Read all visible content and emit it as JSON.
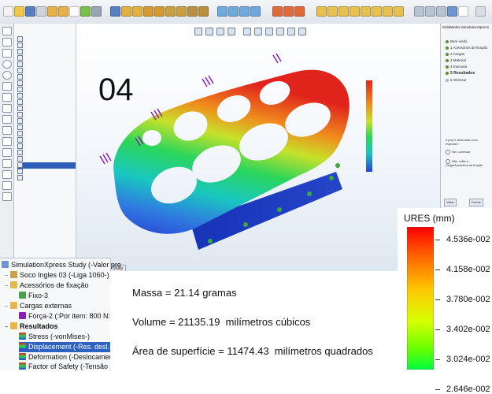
{
  "viewport": {
    "step_number": "04",
    "tab_label": "SimulationXpress Study"
  },
  "big_tree": {
    "items": [
      {
        "label": "SimulationXpress Study (-Valor pre",
        "level": 0,
        "bold": false,
        "selected": false,
        "icon": "study-icon"
      },
      {
        "label": "Soco Ingles 03 (-Liga 1060-)",
        "level": 1,
        "bold": false,
        "selected": false,
        "icon": "part-icon"
      },
      {
        "label": "Acessórios de fixação",
        "level": 1,
        "bold": false,
        "selected": false,
        "icon": "fixture-folder-icon"
      },
      {
        "label": "Fixo-3",
        "level": 2,
        "bold": false,
        "selected": false,
        "icon": "fixed-icon"
      },
      {
        "label": "Cargas externas",
        "level": 1,
        "bold": false,
        "selected": false,
        "icon": "loads-folder-icon"
      },
      {
        "label": "Força-2 (:Por item: 800 N:)",
        "level": 2,
        "bold": false,
        "selected": false,
        "icon": "force-icon"
      },
      {
        "label": "Resultados",
        "level": 1,
        "bold": true,
        "selected": false,
        "icon": "results-folder-icon"
      },
      {
        "label": "Stress (-vonMises-)",
        "level": 2,
        "bold": false,
        "selected": false,
        "icon": "plot-icon"
      },
      {
        "label": "Displacement (-Res. desl.-)",
        "level": 2,
        "bold": false,
        "selected": true,
        "icon": "plot-icon"
      },
      {
        "label": "Deformation (-Deslocamen",
        "level": 2,
        "bold": false,
        "selected": false,
        "icon": "plot-icon"
      },
      {
        "label": "Factor of Safety (-Tensão de",
        "level": 2,
        "bold": false,
        "selected": false,
        "icon": "plot-icon"
      }
    ]
  },
  "properties": {
    "mass": "Massa = 21.14 gramas",
    "volume": "Volume = 21135.19  milímetros cúbicos",
    "area": "Área de superfície = 11474.43  milímetros quadrados"
  },
  "legend": {
    "title": "URES (mm)",
    "ticks": [
      "4.536e-002",
      "4.158e-002",
      "3.780e-002",
      "3.402e-002",
      "3.024e-002",
      "2.646e-002"
    ],
    "values": [
      0.04536,
      0.04158,
      0.0378,
      0.03402,
      0.03024,
      0.02646
    ],
    "gradient_colors": [
      "#ff0000",
      "#ff6a00",
      "#ffc800",
      "#d7ff00",
      "#6cff00",
      "#00ff40"
    ]
  },
  "right_panel": {
    "title": "SolidWorks SimulationXpress",
    "steps": [
      {
        "label": "Bem-vindo",
        "active": false
      },
      {
        "label": "1  Acessórios de fixação",
        "active": false
      },
      {
        "label": "2  Cargas",
        "active": false
      },
      {
        "label": "3  Material",
        "active": false
      },
      {
        "label": "4  Executar",
        "active": false
      },
      {
        "label": "5  Resultados",
        "active": true
      },
      {
        "label": "6  Otimizar",
        "active": false
      }
    ],
    "question": "A peça é deformada como esperado?",
    "options": [
      "Sim, continuar",
      "Não, voltar a Carga/Acessórios de fixação"
    ],
    "buttons": [
      "Voltar",
      "Fechar"
    ]
  },
  "colors": {
    "accent": "#2e62c0",
    "toolbar": "#dfe4ea"
  }
}
